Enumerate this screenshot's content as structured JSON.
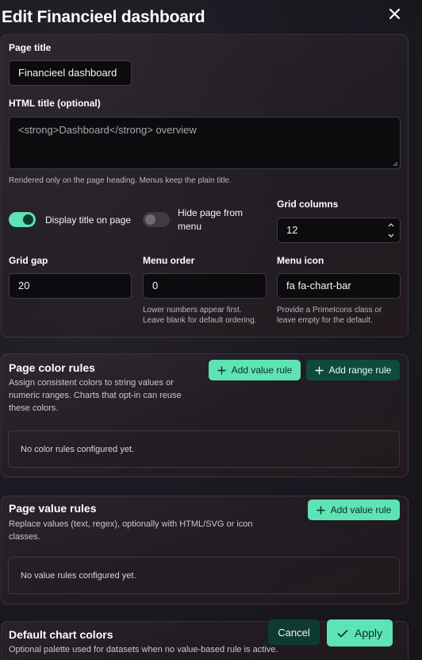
{
  "dialog": {
    "title": "Edit Financieel dashboard"
  },
  "general": {
    "page_title_label": "Page title",
    "page_title_value": "Financieel dashboard",
    "html_title_label": "HTML title (optional)",
    "html_title_value": "<strong>Dashboard</strong> overview",
    "html_title_hint": "Rendered only on the page heading. Menus keep the plain title.",
    "display_title_label": "Display title on page",
    "display_title_on": true,
    "hide_page_label_line1": "Hide page from",
    "hide_page_label_line2": "menu",
    "hide_page_on": false,
    "grid_columns_label": "Grid columns",
    "grid_columns_value": "12",
    "grid_gap_label": "Grid gap",
    "grid_gap_value": "20",
    "menu_order_label": "Menu order",
    "menu_order_value": "0",
    "menu_order_hint_1": "Lower numbers appear first.",
    "menu_order_hint_2": "Leave blank for default ordering.",
    "menu_icon_label": "Menu icon",
    "menu_icon_value": "fa fa-chart-bar",
    "menu_icon_hint_1": "Provide a PrimeIcons class or",
    "menu_icon_hint_2": "leave empty for the default."
  },
  "color_rules": {
    "title": "Page color rules",
    "desc_1": "Assign consistent colors to string values or",
    "desc_2": "numeric ranges. Charts that opt-in can reuse",
    "desc_3": "these colors.",
    "add_value_label": "Add value rule",
    "add_range_label": "Add range rule",
    "empty_text": "No color rules configured yet."
  },
  "value_rules": {
    "title": "Page value rules",
    "desc_1": "Replace values (text, regex), optionally with HTML/SVG or icon",
    "desc_2": "classes.",
    "add_value_label": "Add value rule",
    "empty_text": "No value rules configured yet."
  },
  "chart_colors": {
    "title": "Default chart colors",
    "desc": "Optional palette used for datasets when no value-based rule is active."
  },
  "footer": {
    "cancel_label": "Cancel",
    "apply_label": "Apply"
  },
  "icons": {
    "close": "close-icon",
    "plus": "plus-icon",
    "check": "check-icon",
    "spin_up": "chevron-up-icon",
    "spin_down": "chevron-down-icon"
  },
  "colors": {
    "accent": "#5ee3b4",
    "accent_dark": "#0e4b3a",
    "input_bg": "#0c0c0f"
  }
}
